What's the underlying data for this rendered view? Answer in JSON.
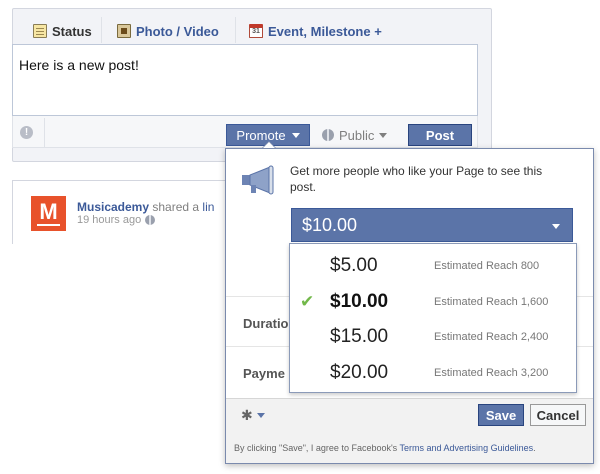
{
  "composer": {
    "tabs": [
      {
        "label": "Status",
        "icon": "status-icon"
      },
      {
        "label": "Photo / Video",
        "icon": "photo-icon"
      },
      {
        "label": "Event, Milestone +",
        "icon": "calendar-icon"
      }
    ],
    "calendar_icon_text": "31",
    "post_text": "Here is a new post!",
    "promote_label": "Promote",
    "audience_label": "Public",
    "post_label": "Post"
  },
  "story": {
    "avatar_letter": "M",
    "page_name": "Musicademy",
    "action_text": " shared a ",
    "link_text": "lin",
    "time": "19 hours ago"
  },
  "promote": {
    "description": "Get more people who like your Page to see this post.",
    "selected_amount": "$10.00",
    "options": [
      {
        "amount": "$5.00",
        "reach": "Estimated Reach 800",
        "selected": false
      },
      {
        "amount": "$10.00",
        "reach": "Estimated Reach 1,600",
        "selected": true
      },
      {
        "amount": "$15.00",
        "reach": "Estimated Reach 2,400",
        "selected": false
      },
      {
        "amount": "$20.00",
        "reach": "Estimated Reach 3,200",
        "selected": false
      }
    ],
    "check_glyph": "✔",
    "duration_label": "Duratio",
    "payment_label": "Payme",
    "save_label": "Save",
    "cancel_label": "Cancel",
    "gear_glyph": "✱",
    "disclaimer_prefix": "By clicking \"Save\", I agree to Facebook's ",
    "disclaimer_link": "Terms and Advertising Guidelines",
    "disclaimer_suffix": "."
  },
  "colors": {
    "brand": "#3b5998",
    "button": "#5b74a8",
    "check": "#72b84a"
  }
}
